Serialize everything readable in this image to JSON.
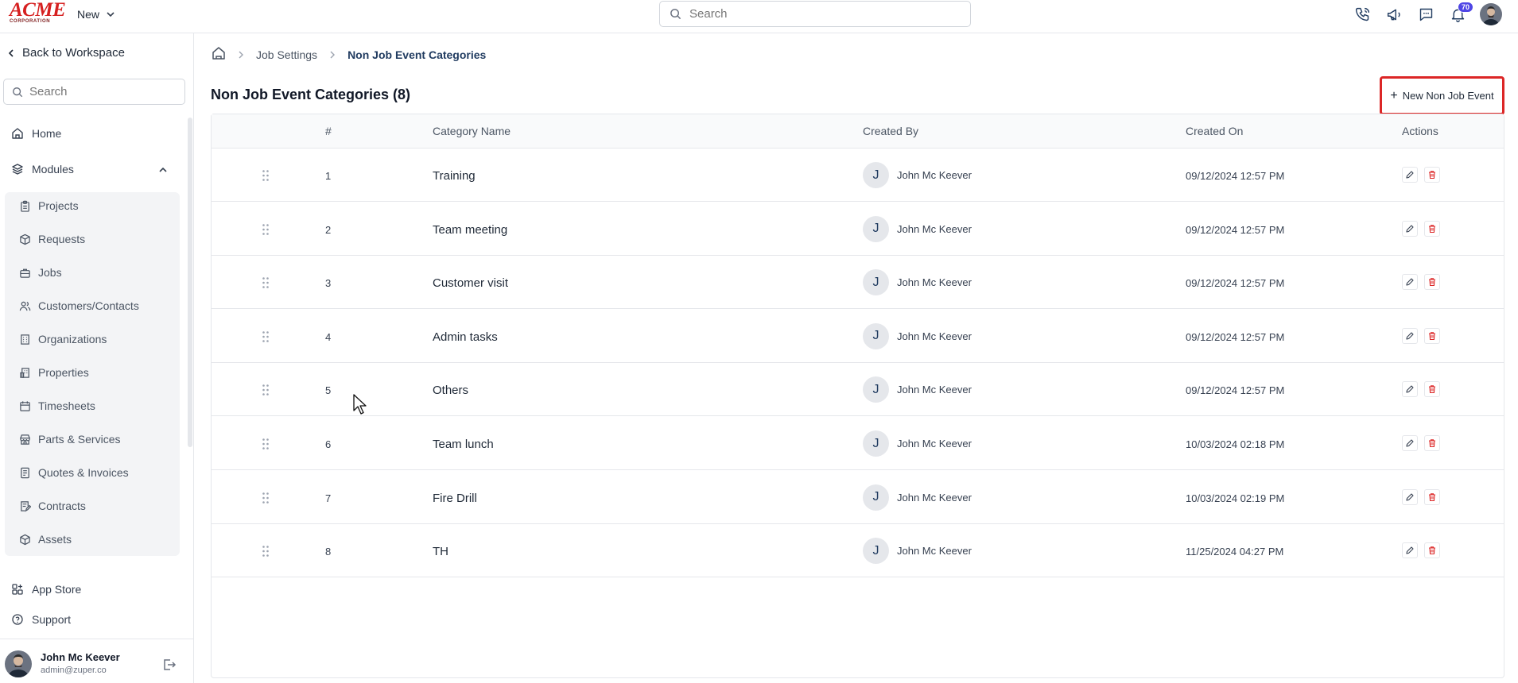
{
  "brand": {
    "logo_word": "ACME",
    "logo_sub": "CORPORATION"
  },
  "topbar": {
    "new_label": "New",
    "search_placeholder": "Search",
    "notification_count": "70"
  },
  "sidebar": {
    "back_label": "Back to Workspace",
    "search_placeholder": "Search",
    "home_label": "Home",
    "modules_label": "Modules",
    "modules": [
      {
        "label": "Projects",
        "icon": "clipboard-icon"
      },
      {
        "label": "Requests",
        "icon": "box-icon"
      },
      {
        "label": "Jobs",
        "icon": "briefcase-icon"
      },
      {
        "label": "Customers/Contacts",
        "icon": "users-icon"
      },
      {
        "label": "Organizations",
        "icon": "building-icon"
      },
      {
        "label": "Properties",
        "icon": "property-icon"
      },
      {
        "label": "Timesheets",
        "icon": "calendar-icon"
      },
      {
        "label": "Parts & Services",
        "icon": "store-icon"
      },
      {
        "label": "Quotes & Invoices",
        "icon": "invoice-icon"
      },
      {
        "label": "Contracts",
        "icon": "contract-icon"
      },
      {
        "label": "Assets",
        "icon": "cube-icon"
      }
    ],
    "app_store_label": "App Store",
    "support_label": "Support",
    "user": {
      "name": "John Mc Keever",
      "email": "admin@zuper.co"
    }
  },
  "breadcrumb": {
    "parent": "Job Settings",
    "current": "Non Job Event Categories"
  },
  "page": {
    "title": "Non Job Event Categories (8)",
    "new_button_label": "New Non Job Event"
  },
  "table": {
    "columns": [
      "#",
      "Category Name",
      "Created By",
      "Created On",
      "Actions"
    ],
    "rows": [
      {
        "num": "1",
        "name": "Training",
        "initial": "J",
        "created_by": "John Mc Keever",
        "created_on": "09/12/2024 12:57 PM"
      },
      {
        "num": "2",
        "name": "Team meeting",
        "initial": "J",
        "created_by": "John Mc Keever",
        "created_on": "09/12/2024 12:57 PM"
      },
      {
        "num": "3",
        "name": "Customer visit",
        "initial": "J",
        "created_by": "John Mc Keever",
        "created_on": "09/12/2024 12:57 PM"
      },
      {
        "num": "4",
        "name": "Admin tasks",
        "initial": "J",
        "created_by": "John Mc Keever",
        "created_on": "09/12/2024 12:57 PM"
      },
      {
        "num": "5",
        "name": "Others",
        "initial": "J",
        "created_by": "John Mc Keever",
        "created_on": "09/12/2024 12:57 PM"
      },
      {
        "num": "6",
        "name": "Team lunch",
        "initial": "J",
        "created_by": "John Mc Keever",
        "created_on": "10/03/2024 02:18 PM"
      },
      {
        "num": "7",
        "name": "Fire Drill",
        "initial": "J",
        "created_by": "John Mc Keever",
        "created_on": "10/03/2024 02:19 PM"
      },
      {
        "num": "8",
        "name": "TH",
        "initial": "J",
        "created_by": "John Mc Keever",
        "created_on": "11/25/2024 04:27 PM"
      }
    ]
  },
  "colors": {
    "accent": "#1f3a5f",
    "brand_red": "#d62020",
    "delete_red": "#dc2626",
    "highlight_border": "#dc2626"
  }
}
